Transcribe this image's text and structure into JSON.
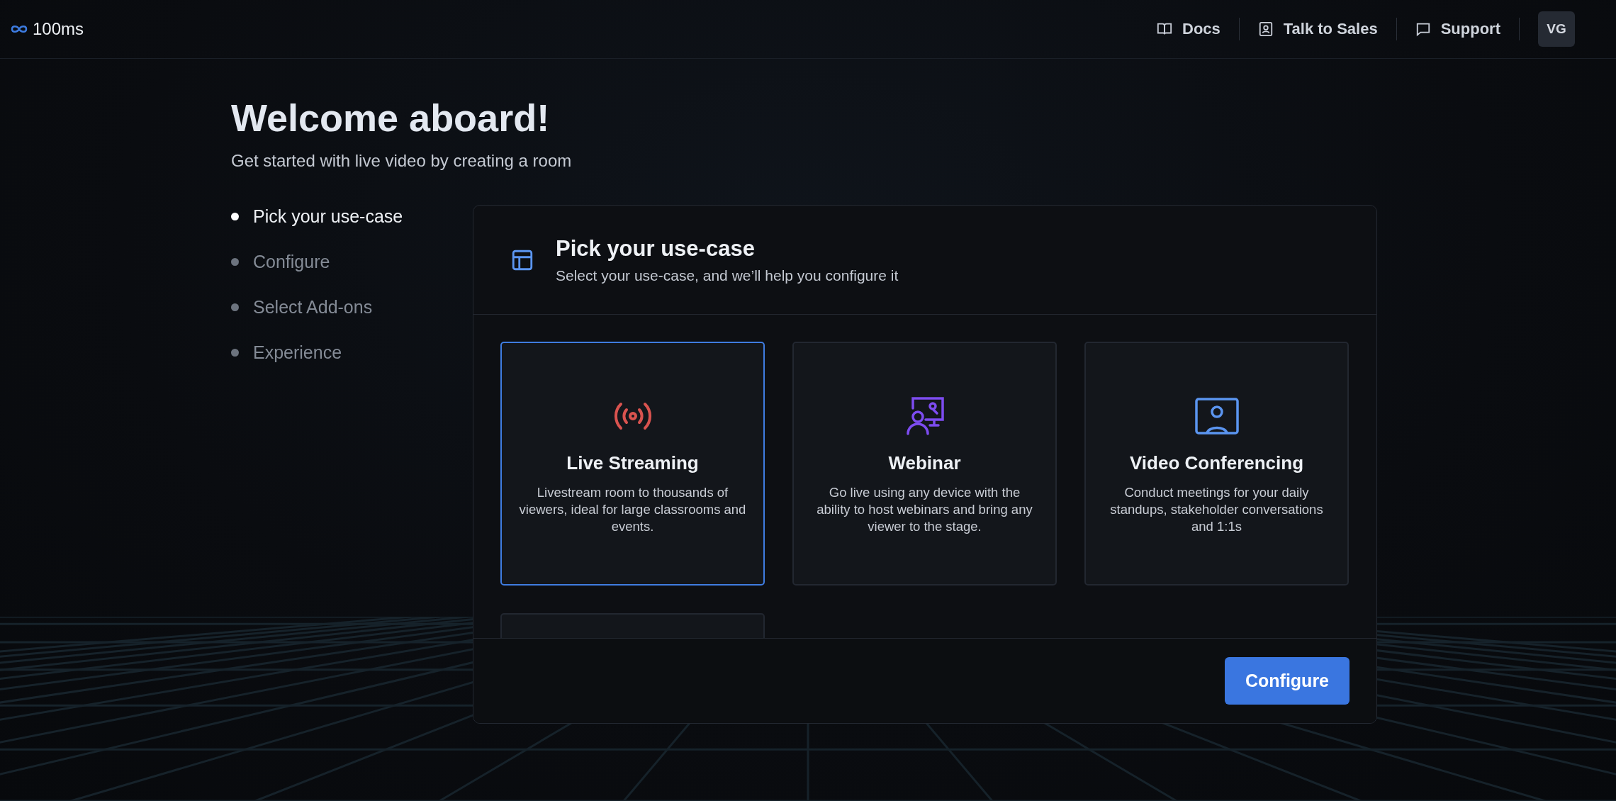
{
  "topbar": {
    "logo": "100ms",
    "links": [
      {
        "kind": "docs",
        "label": "Docs"
      },
      {
        "kind": "sales",
        "label": "Talk to Sales"
      },
      {
        "kind": "support",
        "label": "Support"
      }
    ],
    "avatar": "VG"
  },
  "welcome": {
    "title": "Welcome aboard!",
    "subtitle": "Get started with live video by creating a room"
  },
  "steps": [
    {
      "label": "Pick your use-case",
      "selected": true
    },
    {
      "label": "Configure",
      "selected": false
    },
    {
      "label": "Select Add-ons",
      "selected": false
    },
    {
      "label": "Experience",
      "selected": false
    }
  ],
  "panel": {
    "title": "Pick your use-case",
    "subtitle": "Select your use-case, and we’ll help you configure it",
    "use_cases": [
      {
        "kind": "broadcast",
        "title": "Live Streaming",
        "description": "Livestream room to thousands of viewers, ideal for large classrooms and events.",
        "selected": true
      },
      {
        "kind": "webinar",
        "title": "Webinar",
        "description": "Go live using any device with the ability to host webinars and bring any viewer to the stage.",
        "selected": false
      },
      {
        "kind": "video",
        "title": "Video Conferencing",
        "description": "Conduct meetings for your daily standups, stakeholder conversations and 1:1s",
        "selected": false
      }
    ],
    "button": "Configure"
  }
}
